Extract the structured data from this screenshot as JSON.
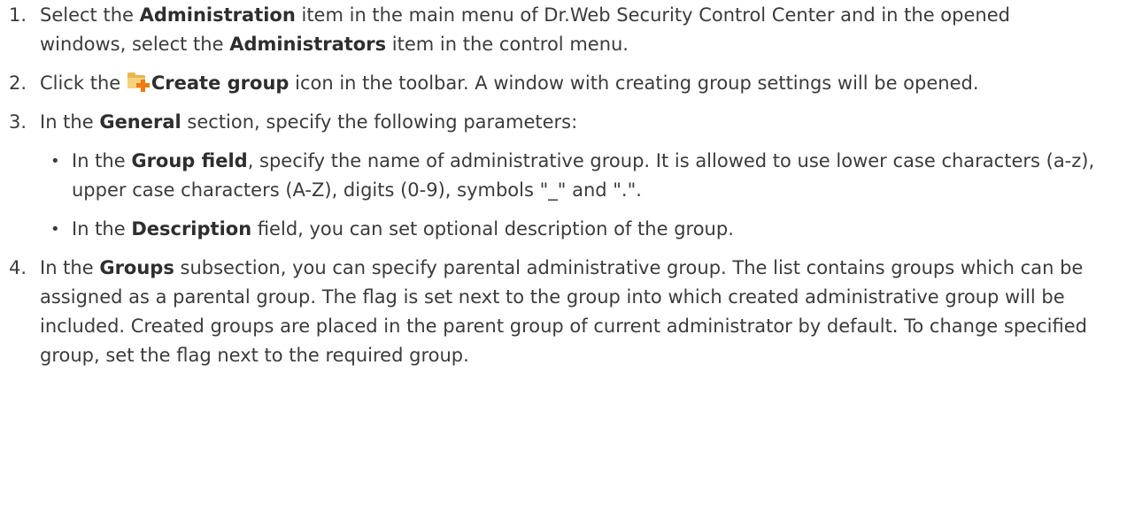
{
  "steps": [
    {
      "num": "1.",
      "t1": "Select the ",
      "b1": "Administration",
      "t2": " item in the main menu of Dr.Web Security Control Center and in the opened windows, select the ",
      "b2": "Administrators",
      "t3": " item in the control menu."
    },
    {
      "num": "2.",
      "t1": "Click the ",
      "icon": "create-group-folder-plus-icon",
      "b1": "Create group",
      "t2": " icon in the toolbar. A window with creating group settings will be opened."
    },
    {
      "num": "3.",
      "t1": "In the ",
      "b1": "General",
      "t2": " section, specify the following parameters:",
      "bullets": [
        {
          "bullet": "•",
          "t1": "In the ",
          "b1": "Group field",
          "t2": ", specify the name of administrative group. It is allowed to use lower case characters (a-z), upper case characters (A-Z), digits (0-9), symbols \"_\" and \".\"."
        },
        {
          "bullet": "•",
          "t1": "In the ",
          "b1": "Description",
          "t2": " field, you can set optional description of the group."
        }
      ]
    },
    {
      "num": "4.",
      "t1": "In the ",
      "b1": "Groups",
      "t2": " subsection, you can specify parental administrative group. The list contains groups which can be assigned as a parental group. The flag is set next to the group into which created administrative group will be included. Created groups are placed in the parent group of current administrator by default. To change specified group, set the flag next to the required group."
    }
  ]
}
